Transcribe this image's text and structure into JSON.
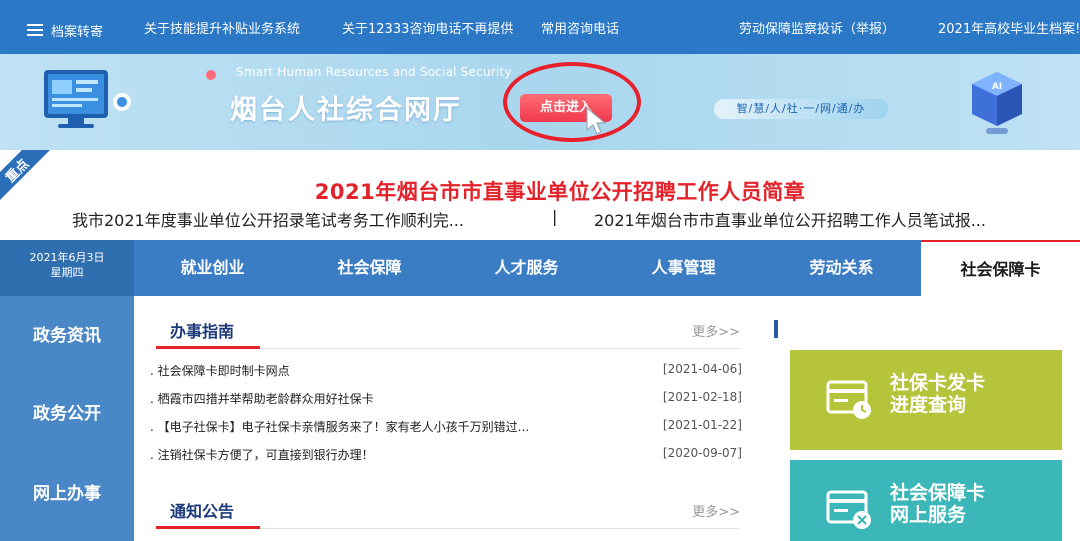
{
  "topnav": {
    "archive": "档案转寄",
    "items": [
      "关于技能提升补贴业务系统",
      "关于12333咨询电话不再提供",
      "常用咨询电话",
      "劳动保障监察投诉（举报）",
      "2021年高校毕业生档案!"
    ]
  },
  "banner": {
    "en_title": "Smart Human Resources and Social Security",
    "cn_title": "烟台人社综合网厅",
    "enter_button": "点击进入",
    "slogan": "智/慧/人/社·一/网/通/办",
    "ai_label": "AI"
  },
  "headline": {
    "badge": "重点",
    "title": "2021年烟台市市直事业单位公开招聘工作人员简章",
    "sub_left": "我市2021年度事业单位公开招录笔试考务工作顺利完...",
    "separator": "|",
    "sub_right": "2021年烟台市市直事业单位公开招聘工作人员笔试报..."
  },
  "date": {
    "date": "2021年6月3日",
    "weekday": "星期四"
  },
  "tabs": [
    "就业创业",
    "社会保障",
    "人才服务",
    "人事管理",
    "劳动关系"
  ],
  "active_tab": "社会保障卡",
  "sidebar": [
    "政务资讯",
    "政务公开",
    "网上办事"
  ],
  "guide": {
    "title": "办事指南",
    "more": "更多>>",
    "items": [
      {
        "title": ". 社会保障卡即时制卡网点",
        "date": "[2021-04-06]"
      },
      {
        "title": ". 栖霞市四措并举帮助老龄群众用好社保卡",
        "date": "[2021-02-18]"
      },
      {
        "title": ". 【电子社保卡】电子社保卡亲情服务来了！家有老人小孩千万别错过...",
        "date": "[2021-01-22]"
      },
      {
        "title": ". 注销社保卡方便了，可直接到银行办理！",
        "date": "[2020-09-07]"
      }
    ]
  },
  "notice": {
    "title": "通知公告",
    "more": "更多>>"
  },
  "cards": [
    {
      "line1": "社保卡发卡",
      "line2": "进度查询",
      "color": "#b5c43a"
    },
    {
      "line1": "社会保障卡",
      "line2": "网上服务",
      "color": "#3cb7b9"
    }
  ],
  "colors": {
    "nav_blue": "#2a78c6",
    "tab_blue": "#3a7dc4",
    "sidebar_blue": "#4a87c6",
    "accent_red": "#e3222a"
  }
}
